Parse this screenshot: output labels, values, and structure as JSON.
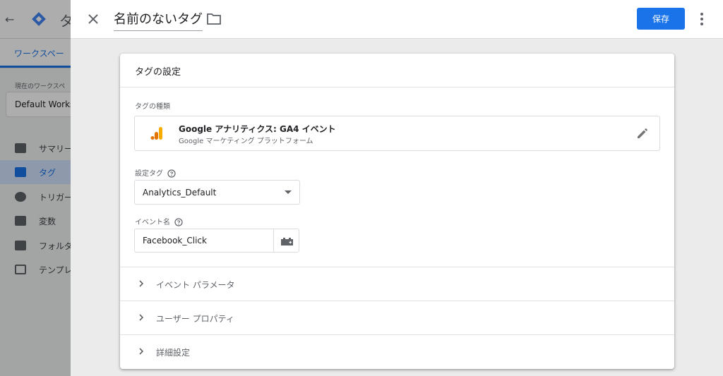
{
  "background": {
    "title_fragment": "タ",
    "tab_label": "ワークスペー",
    "workspace_label": "現在のワークスペ",
    "workspace_name": "Default Works",
    "nav": [
      {
        "label": "サマリー",
        "active": false
      },
      {
        "label": "タグ",
        "active": true
      },
      {
        "label": "トリガー",
        "active": false
      },
      {
        "label": "変数",
        "active": false
      },
      {
        "label": "フォルダ",
        "active": false
      },
      {
        "label": "テンプレ",
        "active": false
      }
    ]
  },
  "header": {
    "tag_name": "名前のないタグ",
    "save_label": "保存"
  },
  "card": {
    "title": "タグの設定",
    "tag_type_label": "タグの種類",
    "tag_type": {
      "name": "Google アナリティクス: GA4 イベント",
      "subtitle": "Google マーケティング プラットフォーム"
    },
    "config_tag_label": "設定タグ",
    "config_tag_value": "Analytics_Default",
    "event_name_label": "イベント名",
    "event_name_value": "Facebook_Click",
    "sections": [
      {
        "label": "イベント パラメータ"
      },
      {
        "label": "ユーザー プロパティ"
      },
      {
        "label": "詳細設定"
      }
    ]
  },
  "colors": {
    "accent": "#1a73e8",
    "ga_orange": "#f9ab00",
    "ga_dark_orange": "#e37400"
  }
}
